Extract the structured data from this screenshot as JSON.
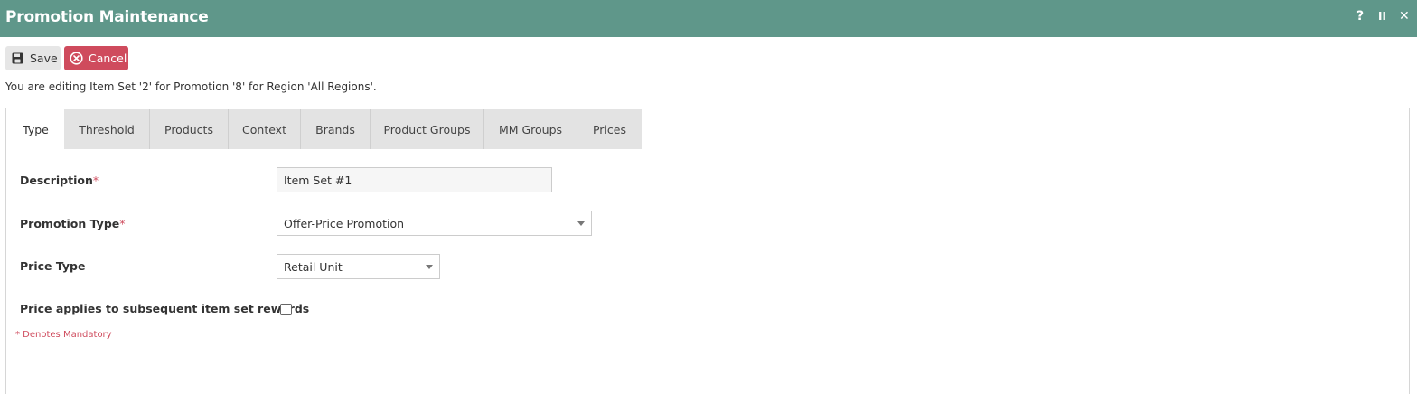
{
  "window": {
    "title": "Promotion Maintenance",
    "controls": {
      "help": "?",
      "pause": "II",
      "close": "✕"
    }
  },
  "toolbar": {
    "save_label": "Save",
    "cancel_label": "Cancel"
  },
  "editing_message": "You are editing Item Set '2' for Promotion '8' for Region 'All Regions'.",
  "tabs": [
    {
      "label": "Type",
      "active": true
    },
    {
      "label": "Threshold",
      "active": false
    },
    {
      "label": "Products",
      "active": false
    },
    {
      "label": "Context",
      "active": false
    },
    {
      "label": "Brands",
      "active": false
    },
    {
      "label": "Product Groups",
      "active": false
    },
    {
      "label": "MM Groups",
      "active": false
    },
    {
      "label": "Prices",
      "active": false
    }
  ],
  "form": {
    "description": {
      "label": "Description",
      "required_mark": "*",
      "value": "Item Set #1"
    },
    "promotion_type": {
      "label": "Promotion Type",
      "required_mark": "*",
      "value": "Offer-Price Promotion"
    },
    "price_type": {
      "label": "Price Type",
      "value": "Retail Unit"
    },
    "price_applies": {
      "label": "Price applies to subsequent item set rewards",
      "checked": false
    },
    "mandatory_note": "* Denotes Mandatory"
  },
  "colors": {
    "titlebar": "#5f978a",
    "cancel": "#cf4b5d",
    "required": "#cf4b5d",
    "tab_inactive": "#e3e3e3"
  }
}
